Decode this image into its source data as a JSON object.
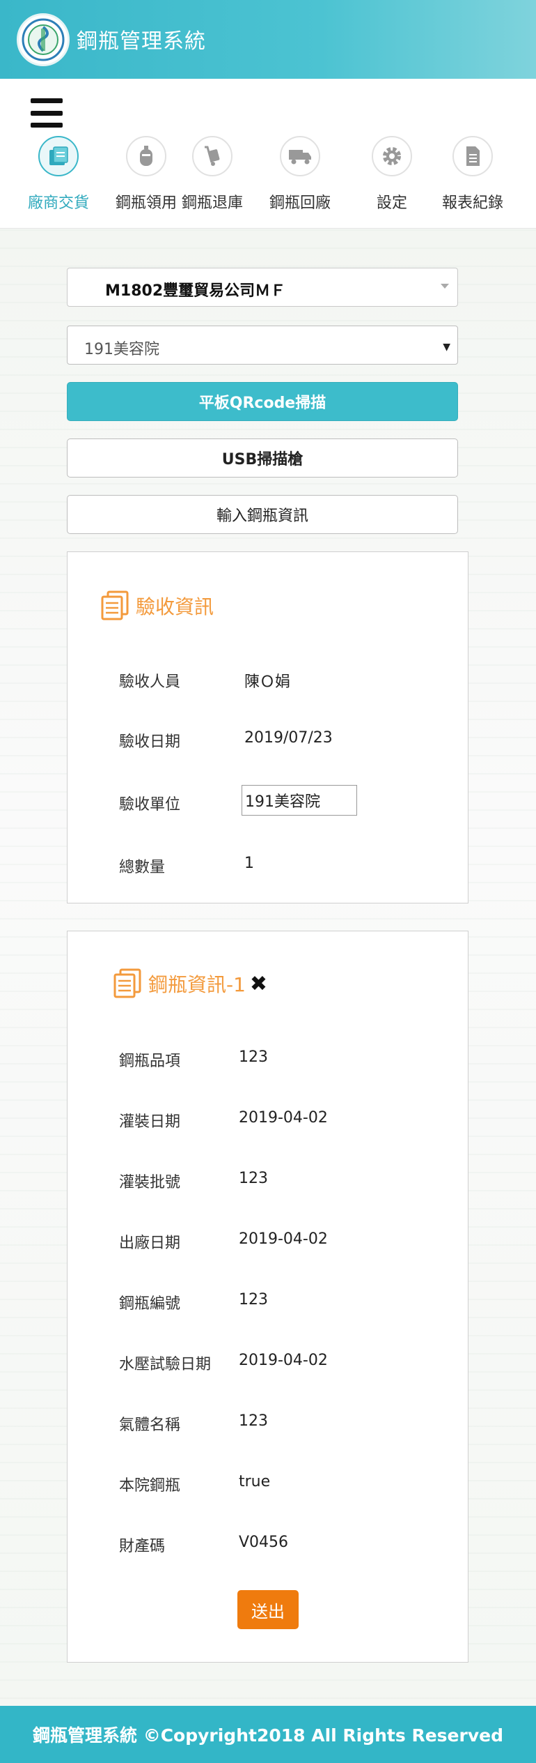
{
  "header": {
    "title": "鋼瓶管理系統"
  },
  "nav": {
    "items": [
      {
        "label": "廠商交貨",
        "icon": "delivery-icon",
        "active": true
      },
      {
        "label": "鋼瓶領用",
        "icon": "gas-cylinder-icon"
      },
      {
        "label": "鋼瓶退庫",
        "icon": "hand-truck-icon"
      },
      {
        "label": "鋼瓶回廠",
        "icon": "truck-icon"
      },
      {
        "label": "設定",
        "icon": "gear-icon"
      },
      {
        "label": "報表紀錄",
        "icon": "report-icon"
      }
    ]
  },
  "form": {
    "vendor_select": "M1802豐璽貿易公司ＭＦ",
    "unit_select": "191美容院",
    "qr_button": "平板QRcode掃描",
    "usb_button": "USB掃描槍",
    "input_button": "輸入鋼瓶資訊"
  },
  "accept": {
    "title": "驗收資訊",
    "inspector_label": "驗收人員",
    "inspector_value": "陳Ｏ娟",
    "date_label": "驗收日期",
    "date_value": "2019/07/23",
    "unit_label": "驗收單位",
    "unit_value": "191美容院",
    "total_label": "總數量",
    "total_value": "1"
  },
  "bottle": {
    "title": "鋼瓶資訊-1",
    "fields": [
      {
        "label": "鋼瓶品項",
        "value": "123"
      },
      {
        "label": "灌裝日期",
        "value": "2019-04-02"
      },
      {
        "label": "灌裝批號",
        "value": "123"
      },
      {
        "label": "出廠日期",
        "value": "2019-04-02"
      },
      {
        "label": "鋼瓶編號",
        "value": "123"
      },
      {
        "label": "水壓試驗日期",
        "value": "2019-04-02"
      },
      {
        "label": "氣體名稱",
        "value": "123"
      },
      {
        "label": "本院鋼瓶",
        "value": "true"
      },
      {
        "label": "財產碼",
        "value": "V0456"
      }
    ],
    "submit_label": "送出",
    "close_glyph": "✖"
  },
  "footer": {
    "text": "鋼瓶管理系統 ©Copyright2018 All Rights Reserved"
  },
  "colors": {
    "primary": "#3ab7c9",
    "accent": "#f39a3c",
    "submit": "#ef7b0e"
  }
}
